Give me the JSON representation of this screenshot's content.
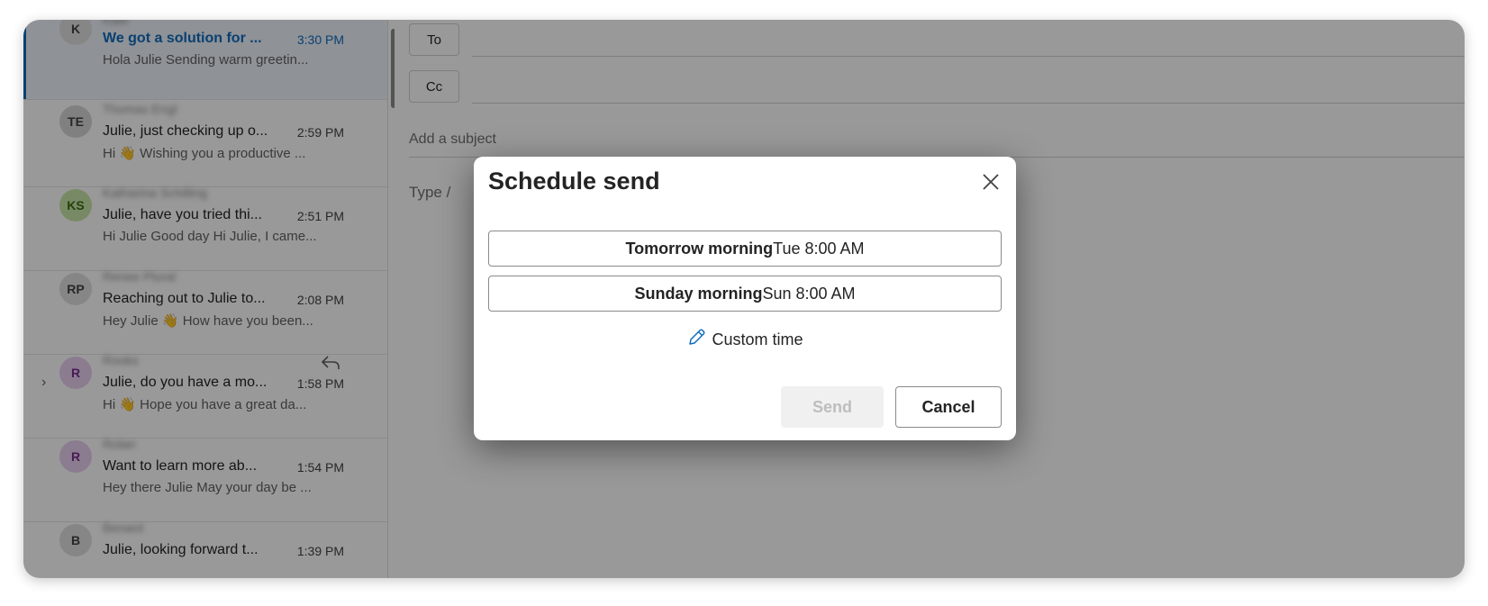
{
  "compose": {
    "to_label": "To",
    "cc_label": "Cc",
    "subject_placeholder": "Add a subject",
    "body_placeholder": "Type /"
  },
  "messages": [
    {
      "initials": "K",
      "sender": "Kate",
      "subject": "We got a solution for ...",
      "time": "3:30 PM",
      "preview": "Hola Julie Sending warm greetin...",
      "avatar_bg": "#e0e0e0",
      "avatar_fg": "#424242",
      "selected": true
    },
    {
      "initials": "TE",
      "sender": "Thomas Engl",
      "subject": "Julie, just checking up o...",
      "time": "2:59 PM",
      "preview": "Hi 👋 Wishing you a productive ...",
      "avatar_bg": "#d6d6d6",
      "avatar_fg": "#424242"
    },
    {
      "initials": "KS",
      "sender": "Katharina Schilling",
      "subject": "Julie, have you tried thi...",
      "time": "2:51 PM",
      "preview": "Hi Julie Good day Hi Julie, I came...",
      "avatar_bg": "#c8e6a9",
      "avatar_fg": "#3b6d11"
    },
    {
      "initials": "RP",
      "sender": "Renee Plural",
      "subject": "Reaching out to Julie to...",
      "time": "2:08 PM",
      "preview": "Hey Julie 👋 How have you been...",
      "avatar_bg": "#e0e0e0",
      "avatar_fg": "#424242"
    },
    {
      "initials": "R",
      "sender": "Rooks",
      "subject": "Julie, do you have a mo...",
      "time": "1:58 PM",
      "preview": "Hi 👋 Hope you have a great da...",
      "avatar_bg": "#e8cff0",
      "avatar_fg": "#7a2e8f",
      "expandable": true,
      "replied": true
    },
    {
      "initials": "R",
      "sender": "Rolan",
      "subject": "Want to learn more ab...",
      "time": "1:54 PM",
      "preview": "Hey there Julie May your day be ...",
      "avatar_bg": "#e8cff0",
      "avatar_fg": "#7a2e8f"
    },
    {
      "initials": "B",
      "sender": "Benard",
      "subject": "Julie, looking forward t...",
      "time": "1:39 PM",
      "preview": "",
      "avatar_bg": "#e0e0e0",
      "avatar_fg": "#424242"
    }
  ],
  "dialog": {
    "title": "Schedule send",
    "options": [
      {
        "label": "Tomorrow morning",
        "detail": "Tue 8:00 AM"
      },
      {
        "label": "Sunday morning",
        "detail": "Sun 8:00 AM"
      }
    ],
    "custom_time": "Custom time",
    "send_label": "Send",
    "cancel_label": "Cancel"
  },
  "colors": {
    "accent": "#0f6cbd",
    "overlay": "rgba(0,0,0,0.4)"
  },
  "icons": [
    "close-icon",
    "pencil-icon",
    "reply-icon",
    "chevron-right-icon"
  ]
}
